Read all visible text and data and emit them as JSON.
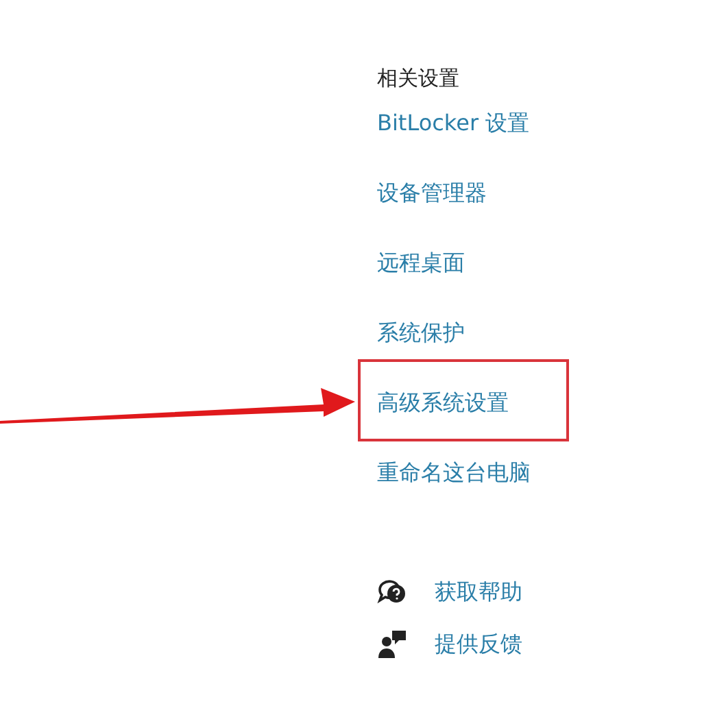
{
  "related_settings": {
    "heading": "相关设置",
    "links": [
      {
        "label": "BitLocker 设置",
        "highlighted": false
      },
      {
        "label": "设备管理器",
        "highlighted": false
      },
      {
        "label": "远程桌面",
        "highlighted": false
      },
      {
        "label": "系统保护",
        "highlighted": false
      },
      {
        "label": "高级系统设置",
        "highlighted": true
      },
      {
        "label": "重命名这台电脑",
        "highlighted": false
      }
    ]
  },
  "support": [
    {
      "kind": "help",
      "label": "获取帮助"
    },
    {
      "kind": "feedback",
      "label": "提供反馈"
    }
  ]
}
